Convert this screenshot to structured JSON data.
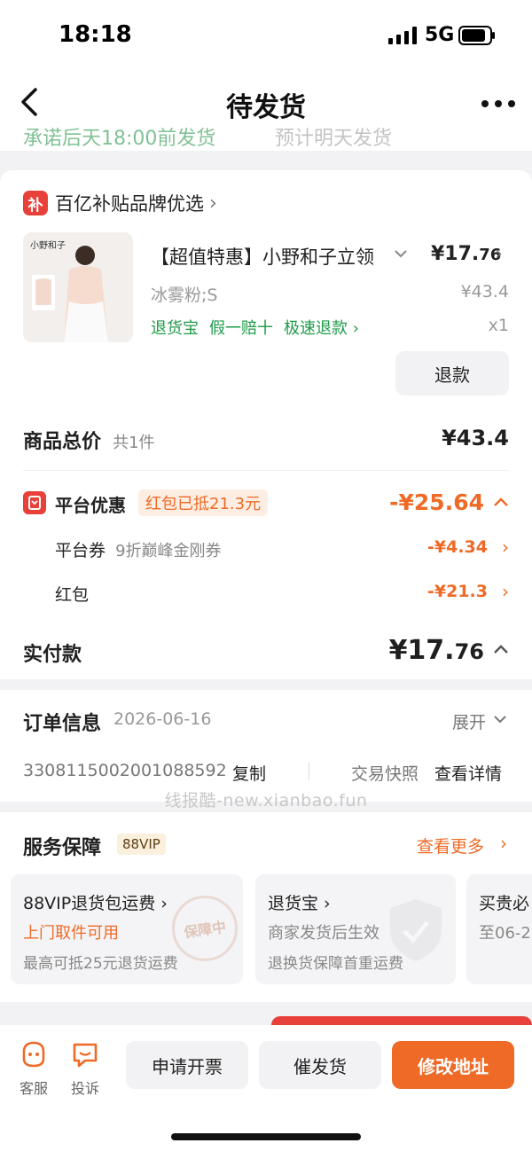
{
  "status_bar": {
    "time": "18:18",
    "network": "5G"
  },
  "nav": {
    "title": "待发货"
  },
  "cut_row": {
    "left": "承诺后天18:00前发货",
    "right": "预计明天发货"
  },
  "brand": {
    "badge": "补",
    "label": "百亿补贴品牌优选"
  },
  "product": {
    "image_logo": "小野和子",
    "name": "【超值特惠】小野和子立领",
    "price_int": "¥17.",
    "price_dec": "76",
    "sku": "冰雾粉;S",
    "original_price": "¥43.4",
    "tags": [
      "退货宝",
      "假一赔十",
      "极速退款 ›"
    ],
    "quantity": "x1",
    "refund_label": "退款"
  },
  "summary": {
    "total_label": "商品总价",
    "total_count": "共1件",
    "total_value": "¥43.4",
    "promo_label": "平台优惠",
    "promo_badge": "红包已抵21.3元",
    "promo_value": "-¥25.64",
    "coupon_label": "平台券",
    "coupon_desc": "9折巅峰金刚券",
    "coupon_value": "-¥4.34",
    "redpacket_label": "红包",
    "redpacket_value": "-¥21.3",
    "paid_label": "实付款",
    "paid_int": "¥17.",
    "paid_dec": "76"
  },
  "order": {
    "title": "订单信息",
    "date": "2026-06-16",
    "expand_label": "展开",
    "number": "3308115002001088592",
    "copy_label": "复制",
    "snapshot_label": "交易快照",
    "detail_label": "查看详情"
  },
  "watermark": "线报酷-new.xianbao.fun",
  "service": {
    "title": "服务保障",
    "tag": "88VIP",
    "more_label": "查看更多",
    "boxes": [
      {
        "title": "88VIP退货包运费 ›",
        "highlight": "上门取件可用",
        "desc": "最高可抵25元退货运费",
        "stamp": "保障中"
      },
      {
        "title": "退货宝 ›",
        "highlight": "商家发货后生效",
        "desc": "退换货保障首重运费"
      },
      {
        "title": "买贵必",
        "highlight": "",
        "desc": "至06-2"
      }
    ]
  },
  "bottom_bar": {
    "service_label": "客服",
    "complain_label": "投诉",
    "invoice_label": "申请开票",
    "urge_label": "催发货",
    "address_label": "修改地址"
  },
  "colors": {
    "accent": "#ee6a26",
    "brand_red": "#e8413a",
    "green": "#1f9b49"
  }
}
